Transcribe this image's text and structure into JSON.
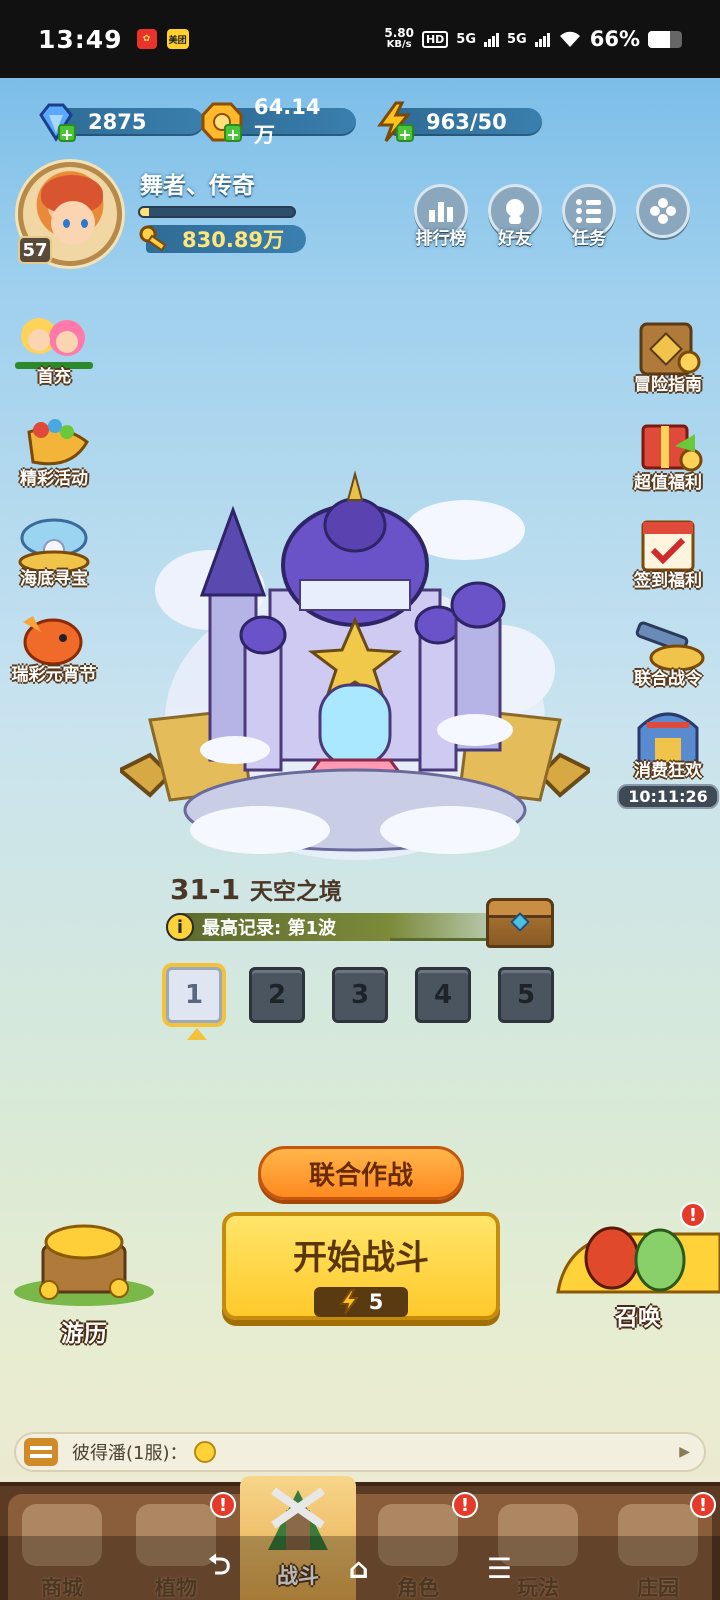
{
  "status_bar": {
    "time": "13:49",
    "net_speed_value": "5.80",
    "net_speed_unit": "KB/s",
    "hd_label": "HD",
    "sig1": "5G",
    "sig2": "5G",
    "battery": "66%",
    "battery_level": 0.66,
    "app_badge_2": "美团"
  },
  "resources": {
    "diamonds": "2875",
    "gold": "64.14万",
    "energy": "963/50"
  },
  "player": {
    "name": "舞者、传奇",
    "level": "57",
    "power": "830.89万",
    "xp_fraction": 0.06
  },
  "top_buttons": {
    "rank": "排行榜",
    "friends": "好友",
    "tasks": "任务"
  },
  "left_side": [
    {
      "label": "首充"
    },
    {
      "label": "精彩活动"
    },
    {
      "label": "海底寻宝"
    },
    {
      "label": "瑞彩元宵节"
    }
  ],
  "right_side": [
    {
      "label": "冒险指南"
    },
    {
      "label": "超值福利"
    },
    {
      "label": "签到福利"
    },
    {
      "label": "联合战令"
    },
    {
      "label": "消费狂欢",
      "timer": "10:11:26"
    }
  ],
  "stage": {
    "number": "31-1",
    "name": "天空之境",
    "record_icon": "i",
    "record": "最高记录: 第1波",
    "waves": [
      "1",
      "2",
      "3",
      "4",
      "5"
    ],
    "selected_wave": "1"
  },
  "actions": {
    "coop": "联合作战",
    "start": "开始战斗",
    "start_cost": "5",
    "travel": "游历",
    "summon": "召唤",
    "badge": "!"
  },
  "chat": {
    "text": "彼得潘(1服)："
  },
  "tabs": [
    {
      "label": "商城"
    },
    {
      "label": "植物"
    },
    {
      "label": "战斗"
    },
    {
      "label": "角色"
    },
    {
      "label": "玩法"
    },
    {
      "label": "庄园"
    }
  ],
  "colors": {
    "accent_gold": "#ffc92a",
    "button_orange": "#ff8a1f",
    "badge_red": "#e53a2a"
  }
}
